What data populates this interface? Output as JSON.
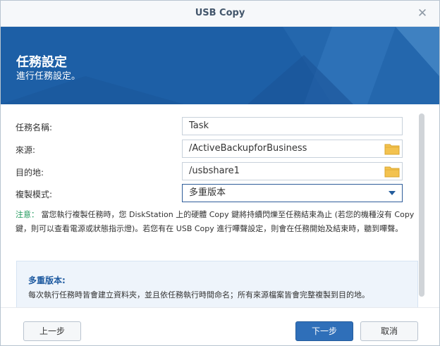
{
  "window": {
    "title": "USB Copy"
  },
  "header": {
    "title": "任務設定",
    "subtitle": "進行任務設定。"
  },
  "form": {
    "task_name": {
      "label": "任務名稱:",
      "value": "Task"
    },
    "source": {
      "label": "來源:",
      "value": "/ActiveBackupforBusiness"
    },
    "destination": {
      "label": "目的地:",
      "value": "/usbshare1"
    },
    "copy_mode": {
      "label": "複製模式:",
      "value": "多重版本"
    }
  },
  "note": {
    "label": "注意：",
    "text": "當您執行複製任務時，您 DiskStation 上的硬體 Copy 鍵將持續閃爍至任務結束為止 (若您的機種沒有 Copy 鍵，則可以查看電源或狀態指示燈)。若您有在 USB Copy 進行嗶聲設定，則會在任務開始及結束時，聽到嗶聲。"
  },
  "info": {
    "title": "多重版本:",
    "text": "每次執行任務時皆會建立資料夾，並且依任務執行時間命名；所有來源檔案皆會完整複製到目的地。"
  },
  "footer": {
    "back_label": "上一步",
    "next_label": "下一步",
    "cancel_label": "取消"
  },
  "colors": {
    "banner": "#1d5fa6",
    "primary_button": "#2f6fb9",
    "note_label": "#1f9a5c",
    "info_title": "#1e5aa0"
  },
  "icons": {
    "close": "close-icon",
    "folder": "folder-icon",
    "dropdown": "chevron-down-icon"
  }
}
